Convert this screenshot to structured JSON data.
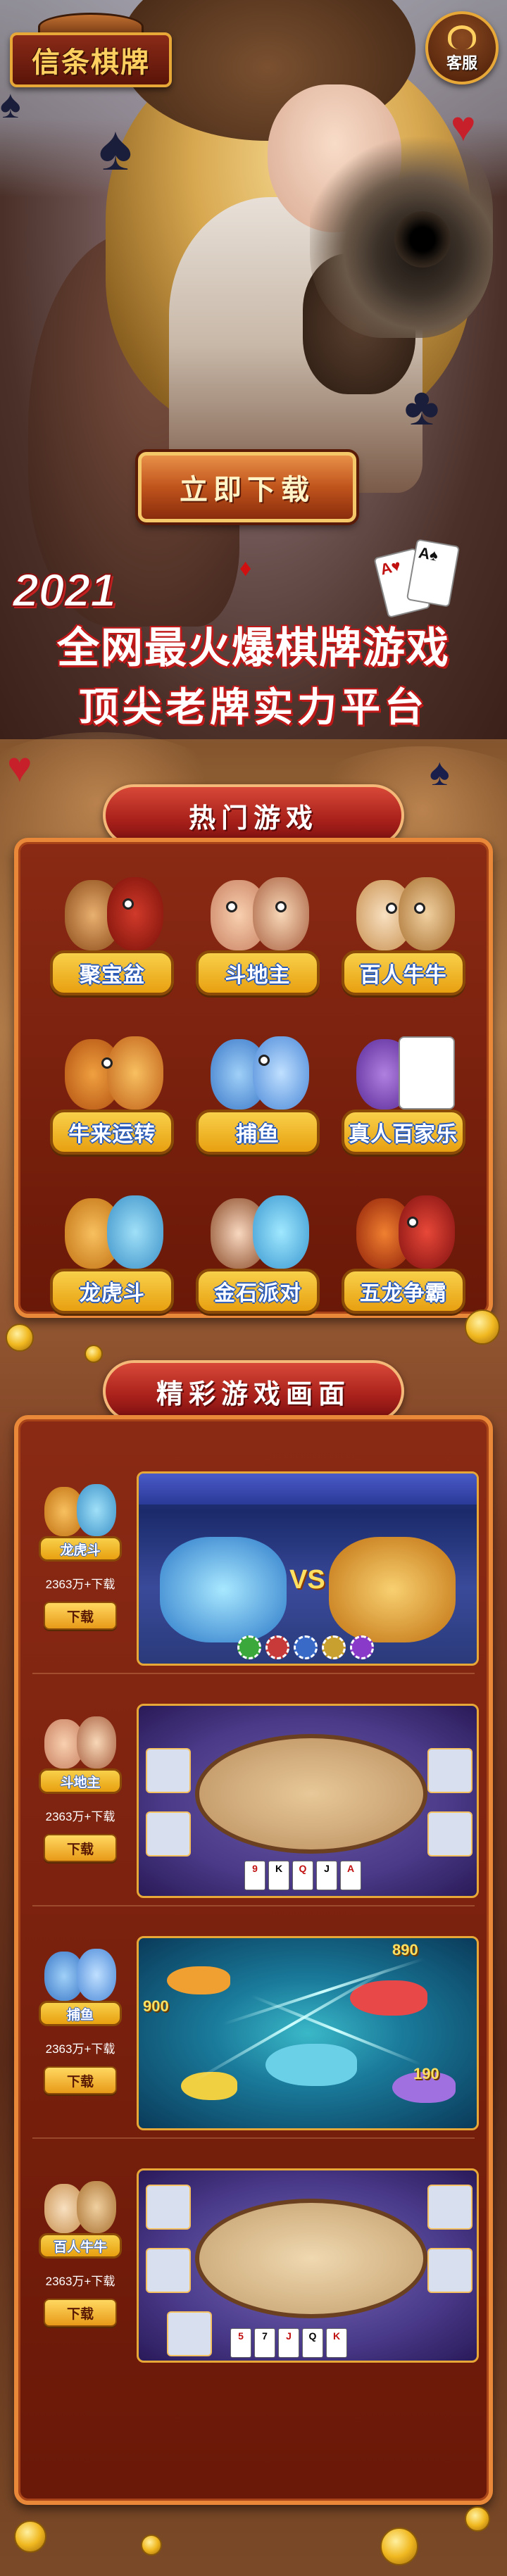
{
  "brand": {
    "logo_text": "信条棋牌"
  },
  "header": {
    "service_label": "客服"
  },
  "hero": {
    "download_label": "立即下载",
    "year": "2021",
    "line1": "全网最火爆棋牌游戏",
    "line2": "顶尖老牌实力平台"
  },
  "hot_games": {
    "title": "热门游戏",
    "items": [
      {
        "label": "聚宝盆",
        "icon": "fortune-god-icon"
      },
      {
        "label": "斗地主",
        "icon": "landlord-icon"
      },
      {
        "label": "百人牛牛",
        "icon": "bull-icon"
      },
      {
        "label": "牛来运转",
        "icon": "bull-luck-icon"
      },
      {
        "label": "捕鱼",
        "icon": "fishing-icon"
      },
      {
        "label": "真人百家乐",
        "icon": "baccarat-cards-icon"
      },
      {
        "label": "龙虎斗",
        "icon": "dragon-tiger-icon"
      },
      {
        "label": "金石派对",
        "icon": "gem-party-icon"
      },
      {
        "label": "五龙争霸",
        "icon": "five-dragons-icon"
      }
    ]
  },
  "showcase": {
    "title": "精彩游戏画面",
    "rows": [
      {
        "tag": "龙虎斗",
        "count": "2363万+下载",
        "download": "下载",
        "screen": "dragon-tiger-battle",
        "vs": "VS"
      },
      {
        "tag": "斗地主",
        "count": "2363万+下载",
        "download": "下载",
        "screen": "card-table"
      },
      {
        "tag": "捕鱼",
        "count": "2363万+下载",
        "download": "下载",
        "screen": "fishing",
        "nums": [
          "900",
          "890",
          "190"
        ]
      },
      {
        "tag": "百人牛牛",
        "count": "2363万+下载",
        "download": "下载",
        "screen": "bull-table"
      }
    ]
  },
  "colors": {
    "accent_gold": "#e8a838",
    "banner_red": "#a8201a",
    "panel_red": "#8a2a14",
    "label_blue_stroke": "#2a5ab8"
  }
}
